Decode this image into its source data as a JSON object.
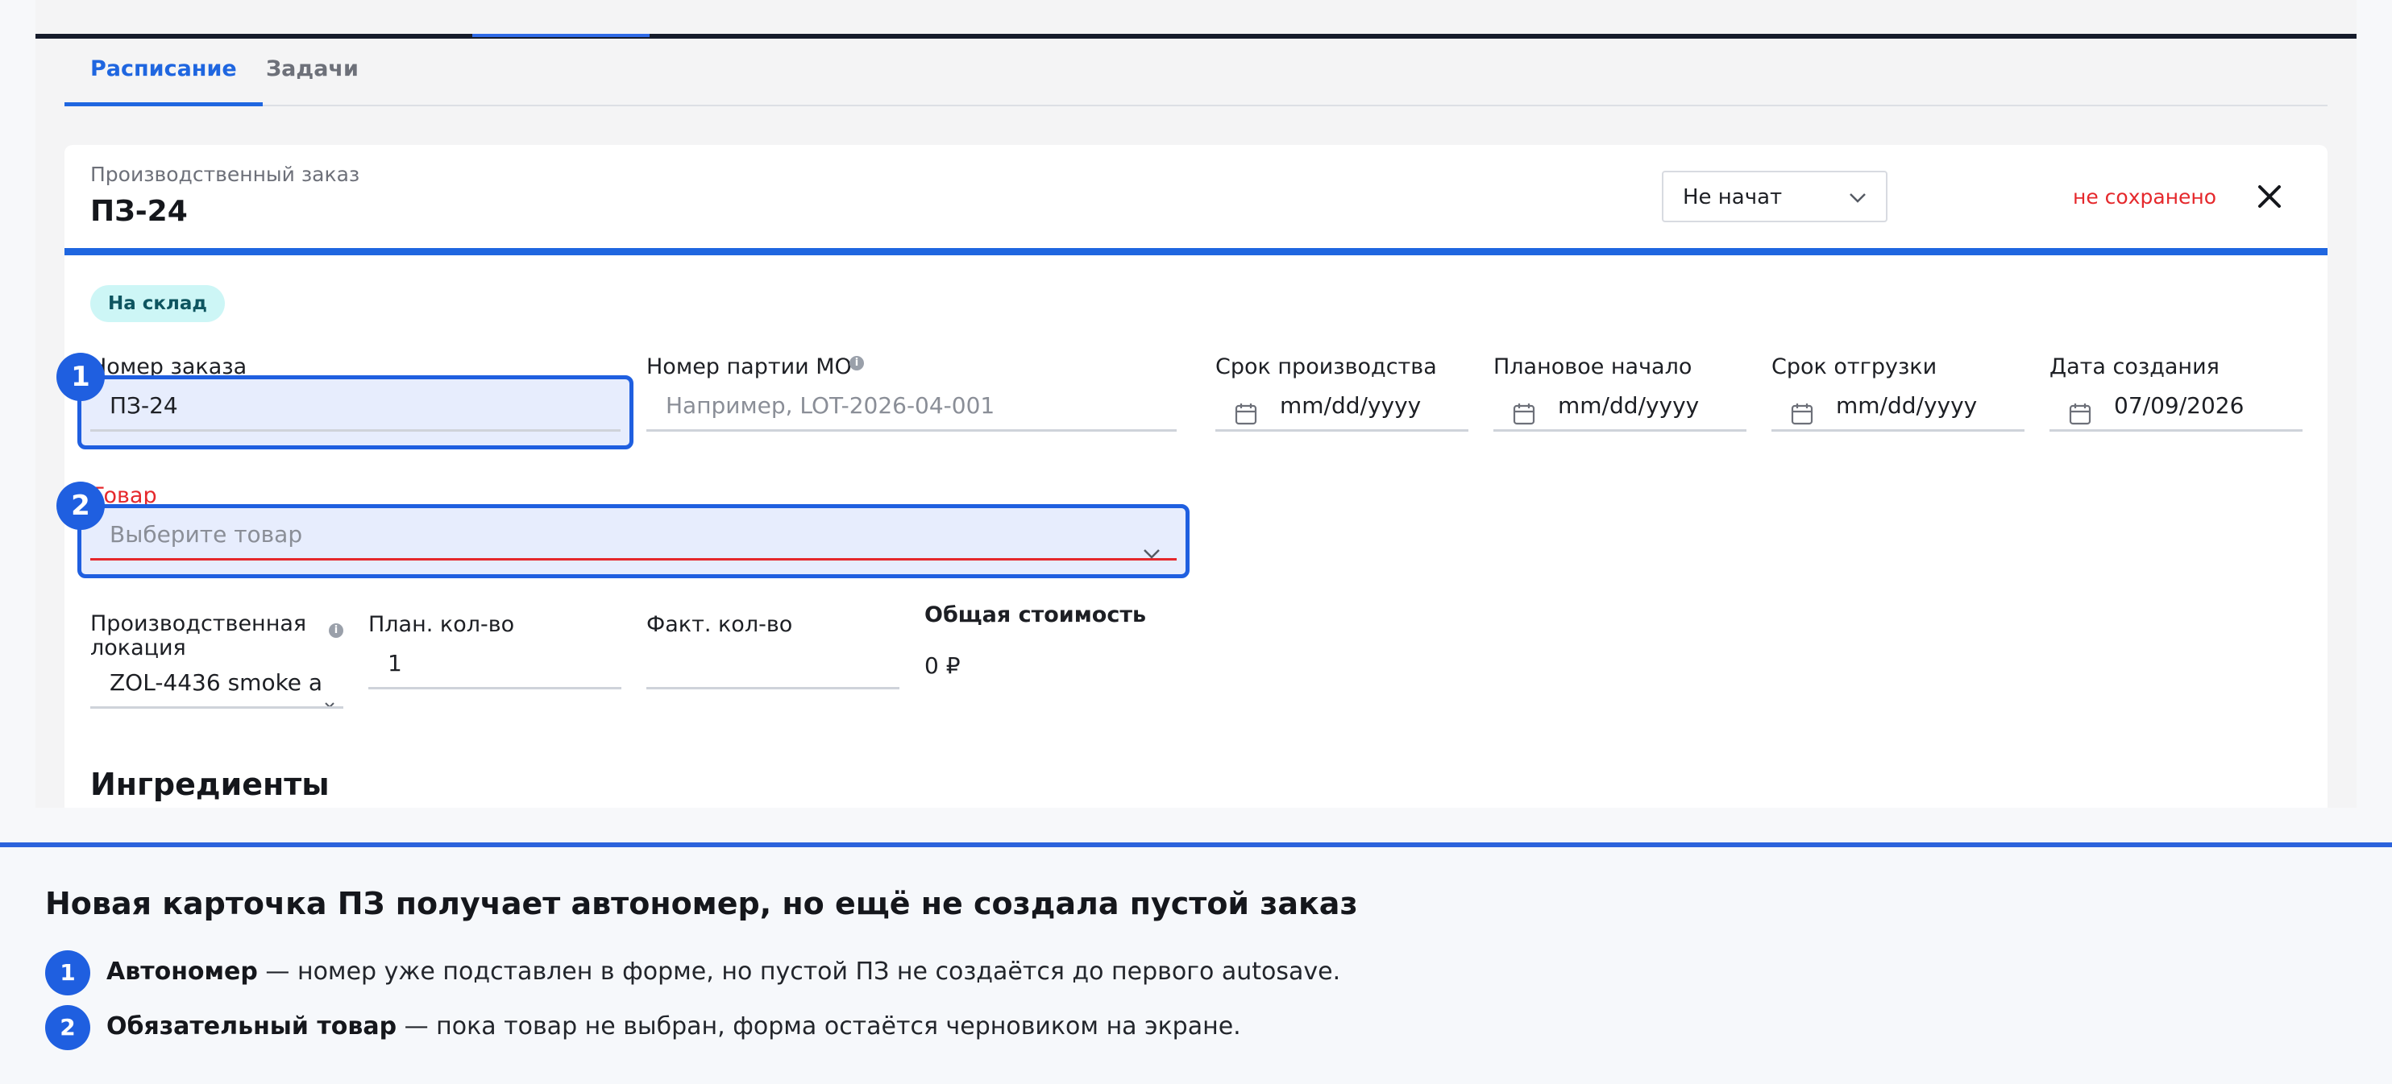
{
  "tabs": [
    {
      "label": "Расписание",
      "active": true
    },
    {
      "label": "Задачи",
      "active": false
    }
  ],
  "card": {
    "subtitle": "Производственный заказ",
    "title": "ПЗ-24",
    "status_value": "Не начат",
    "save_state": "не сохранено",
    "badge": "На склад"
  },
  "fields": {
    "order_number": {
      "label": "Номер заказа",
      "value": "ПЗ-24"
    },
    "batch_number": {
      "label": "Номер партии MO",
      "placeholder": "Например, LOT-2026-04-001"
    },
    "production_deadline": {
      "label": "Срок производства",
      "value": "mm/dd/yyyy"
    },
    "planned_start": {
      "label": "Плановое начало",
      "value": "mm/dd/yyyy"
    },
    "shipping_deadline": {
      "label": "Срок отгрузки",
      "value": "mm/dd/yyyy"
    },
    "created_date": {
      "label": "Дата создания",
      "value": "07/09/2026"
    },
    "product": {
      "label": "Товар",
      "placeholder": "Выберите товар"
    },
    "location": {
      "label_line1": "Производственная",
      "label_line2": "локация",
      "value": "ZOL-4436 smoke a"
    },
    "planned_qty": {
      "label": "План. кол-во",
      "value": "1"
    },
    "actual_qty": {
      "label": "Факт. кол-во",
      "value": ""
    },
    "total_cost": {
      "label": "Общая стоимость",
      "value": "0 ₽"
    }
  },
  "section_ingredients": "Ингредиенты",
  "markers": [
    "1",
    "2"
  ],
  "legend": {
    "title": "Новая карточка ПЗ получает автономер, но ещё не создала пустой заказ",
    "items": [
      {
        "num": "1",
        "term": "Автономер",
        "text": " — номер уже подставлен в форме, но пустой ПЗ не создаётся до первого autosave."
      },
      {
        "num": "2",
        "term": "Обязательный товар",
        "text": " — пока товар не выбран, форма остаётся черновиком на экране."
      }
    ]
  },
  "colors": {
    "accent": "#1f66e0",
    "error": "#e5282c",
    "badge_bg": "#cdf6f6",
    "highlight": "#1f5fe0"
  },
  "icons": [
    "chevron-down-icon",
    "close-icon",
    "calendar-icon",
    "info-icon"
  ]
}
